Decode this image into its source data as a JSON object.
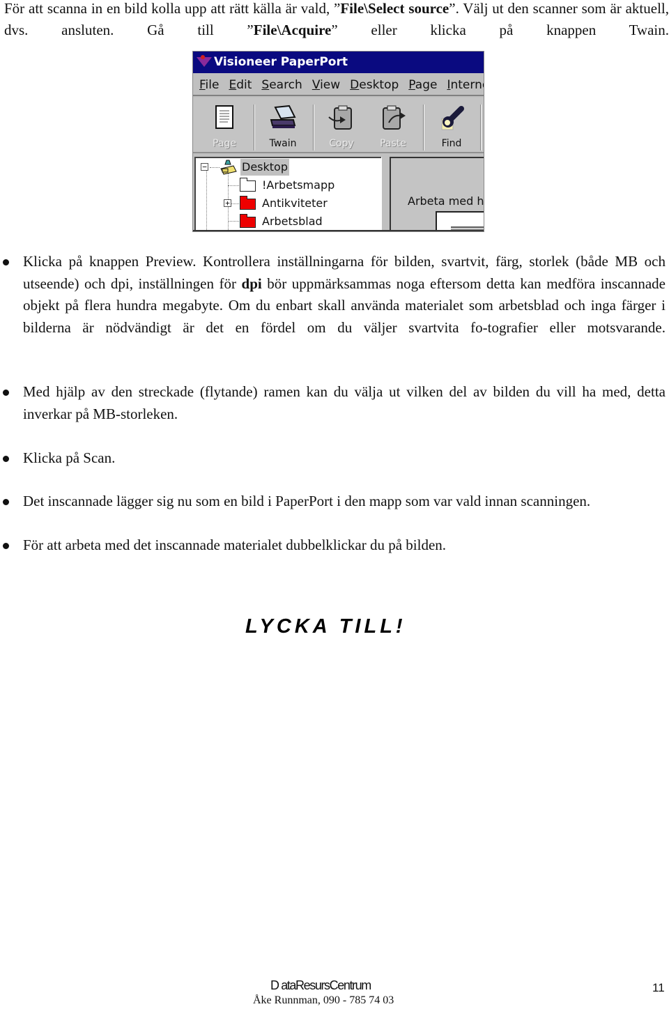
{
  "intro": {
    "part1": "För att scanna in en bild kolla upp att rätt källa är vald, ”",
    "bold1": "File\\Select source",
    "part2": "”. Välj ut den scanner som är aktuell, dvs. ansluten. Gå till ”",
    "bold2": "File\\Acquire",
    "part3": "” eller klicka på knappen Twain."
  },
  "screenshot": {
    "title": "Visioneer PaperPort",
    "menu": [
      {
        "key": "F",
        "rest": "ile"
      },
      {
        "key": "E",
        "rest": "dit"
      },
      {
        "key": "S",
        "rest": "earch"
      },
      {
        "key": "V",
        "rest": "iew"
      },
      {
        "key": "D",
        "rest": "esktop"
      },
      {
        "key": "P",
        "rest": "age"
      },
      {
        "key": "I",
        "rest": "nternet"
      }
    ],
    "toolbar": [
      {
        "label": "Page",
        "icon": "page-icon",
        "enabled": false
      },
      {
        "label": "Twain",
        "icon": "scanner-icon",
        "enabled": true
      },
      {
        "label": "Copy",
        "icon": "clipboard-copy-icon",
        "enabled": false
      },
      {
        "label": "Paste",
        "icon": "clipboard-paste-icon",
        "enabled": false
      },
      {
        "label": "Find",
        "icon": "flashlight-icon",
        "enabled": true
      }
    ],
    "tree": [
      {
        "label": "Desktop",
        "expander": "−",
        "icon": "desktop-icon",
        "selected": true
      },
      {
        "label": "!Arbetsmapp",
        "icon": "folder-white-icon",
        "color": "#ffffff"
      },
      {
        "label": "Antikviteter",
        "expander": "+",
        "icon": "folder-red-icon",
        "color": "#ee0000"
      },
      {
        "label": "Arbetsblad",
        "icon": "folder-red-icon",
        "color": "#ee0000"
      }
    ],
    "pane_text": "Arbeta med hä"
  },
  "bullets": [
    {
      "pre": "Klicka på knappen Preview. Kontrollera inställningarna för bilden, svartvit, färg, storlek (både MB och utseende) och dpi, inställningen för ",
      "bold": "dpi",
      "post": " bör uppmärksammas noga eftersom detta kan medföra inscannade objekt på flera hundra megabyte. Om du enbart skall använda materialet som arbetsblad och inga färger i bilderna är nödvändigt är det en fördel om du väljer svartvita fo-tografier eller motsvarande."
    },
    {
      "text": "Med hjälp av den streckade (flytande) ramen kan du välja ut vilken del av bilden du vill ha med, detta inverkar på MB-storleken."
    },
    {
      "text": "Klicka på Scan."
    },
    {
      "text": "Det inscannade lägger sig nu som en bild i PaperPort i den mapp som var vald innan scanningen."
    },
    {
      "text": "För att arbeta med det inscannade materialet dubbelklickar du på bilden."
    }
  ],
  "closing": "LYCKA TILL!",
  "footer": {
    "org": "D ataResursCentrum",
    "contact": "Åke Runnman, 090 - 785 74 03",
    "page_number": "11"
  }
}
